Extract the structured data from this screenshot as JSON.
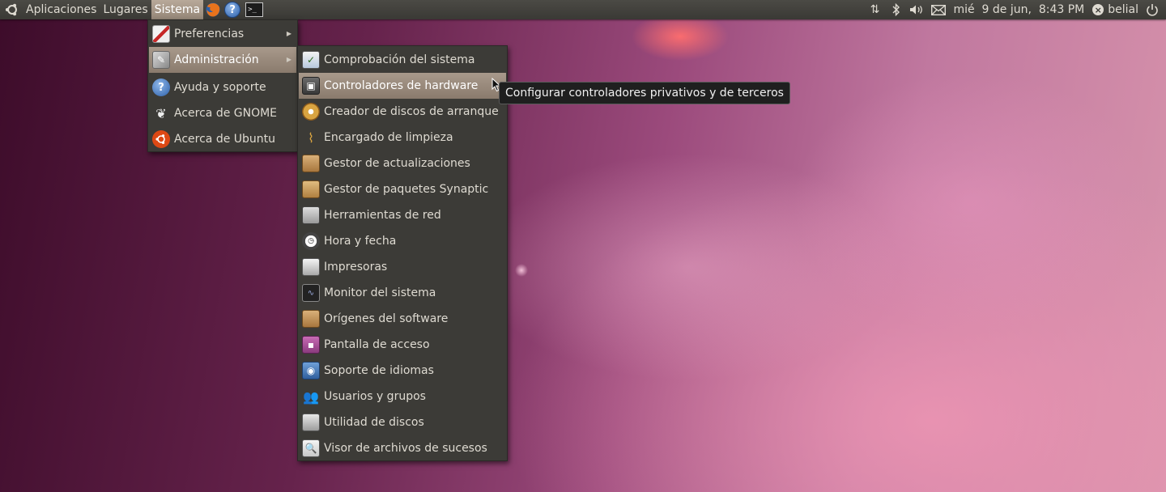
{
  "panel": {
    "menus": [
      "Aplicaciones",
      "Lugares",
      "Sistema"
    ],
    "active_menu": "Sistema",
    "clock": "mié  9 de jun,  8:43 PM",
    "user": "belial"
  },
  "system_menu": {
    "items": [
      {
        "label": "Preferencias",
        "icon": "preferences-icon",
        "submenu": true
      },
      {
        "label": "Administración",
        "icon": "administration-icon",
        "submenu": true,
        "active": true
      },
      {
        "label": "Ayuda y soporte",
        "icon": "help-icon"
      },
      {
        "label": "Acerca de GNOME",
        "icon": "gnome-foot-icon"
      },
      {
        "label": "Acerca de Ubuntu",
        "icon": "ubuntu-logo-icon"
      }
    ]
  },
  "admin_menu": {
    "items": [
      {
        "label": "Comprobación del sistema",
        "icon": "system-check-icon"
      },
      {
        "label": "Controladores de hardware",
        "icon": "hardware-drivers-icon",
        "active": true
      },
      {
        "label": "Creador de discos de arranque",
        "icon": "startup-disk-icon"
      },
      {
        "label": "Encargado de limpieza",
        "icon": "broom-icon"
      },
      {
        "label": "Gestor de actualizaciones",
        "icon": "update-manager-icon"
      },
      {
        "label": "Gestor de paquetes Synaptic",
        "icon": "synaptic-icon"
      },
      {
        "label": "Herramientas de red",
        "icon": "network-tools-icon"
      },
      {
        "label": "Hora y fecha",
        "icon": "time-date-icon"
      },
      {
        "label": "Impresoras",
        "icon": "printer-icon"
      },
      {
        "label": "Monitor del sistema",
        "icon": "system-monitor-icon"
      },
      {
        "label": "Orígenes del software",
        "icon": "software-sources-icon"
      },
      {
        "label": "Pantalla de acceso",
        "icon": "login-screen-icon"
      },
      {
        "label": "Soporte de idiomas",
        "icon": "language-support-icon"
      },
      {
        "label": "Usuarios y grupos",
        "icon": "users-groups-icon"
      },
      {
        "label": "Utilidad de discos",
        "icon": "disk-utility-icon"
      },
      {
        "label": "Visor de archivos de sucesos",
        "icon": "log-viewer-icon"
      }
    ]
  },
  "tooltip": {
    "text": "Configurar controladores privativos y de terceros"
  },
  "colors": {
    "panel_bg": "#3c3b37",
    "menu_bg": "#3c3b37",
    "highlight": "#9a8b7d",
    "menu_text": "#dfdbd2"
  }
}
